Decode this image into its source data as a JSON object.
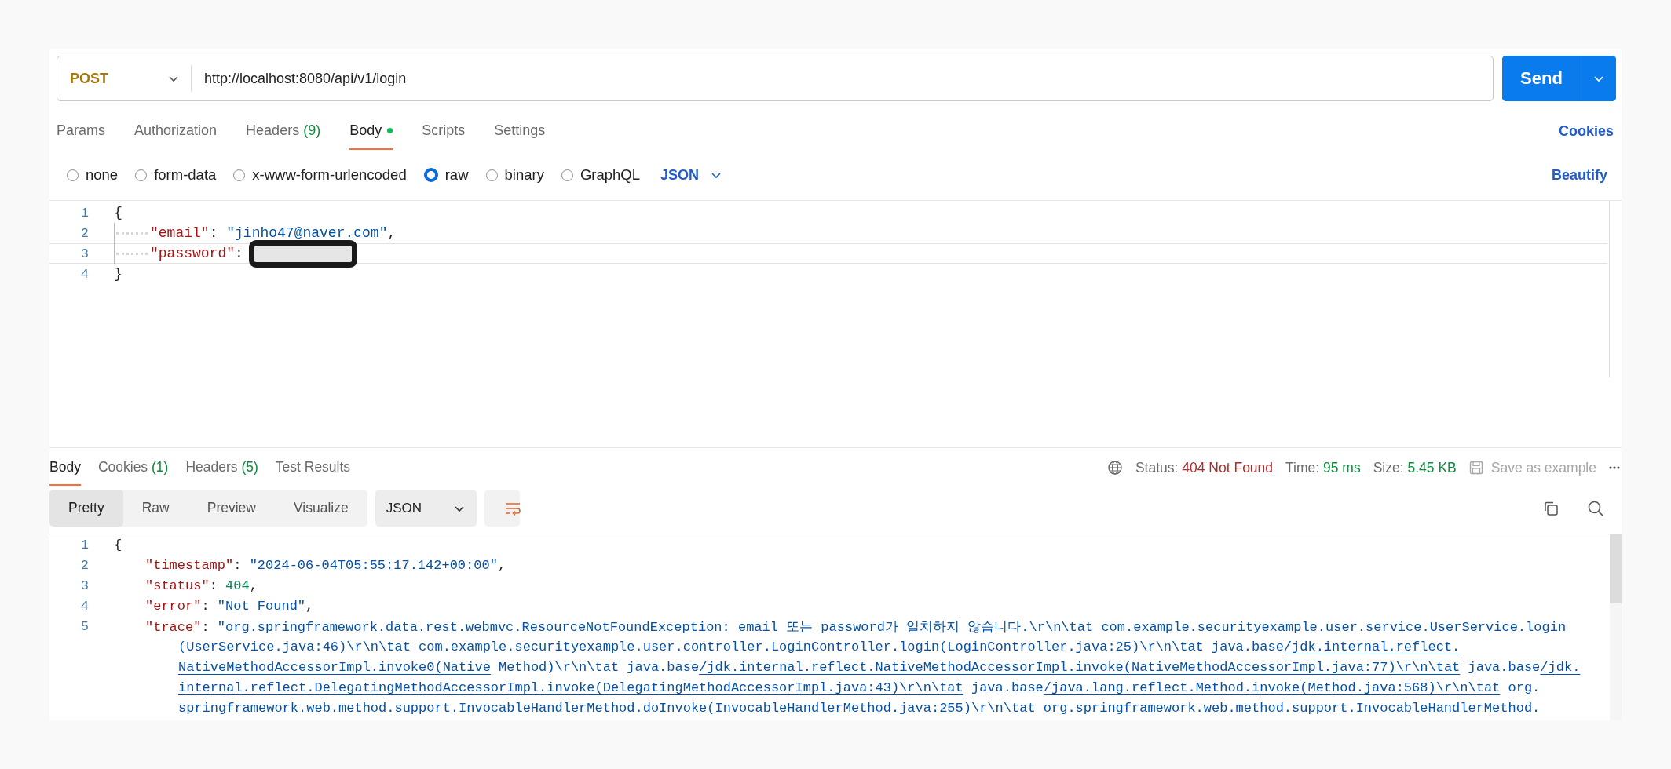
{
  "request": {
    "method": "POST",
    "url": "http://localhost:8080/api/v1/login",
    "send_label": "Send"
  },
  "request_tabs": [
    {
      "label": "Params",
      "selected": false,
      "has_content": false
    },
    {
      "label": "Authorization",
      "selected": false,
      "has_content": false
    },
    {
      "label": "Headers",
      "count": "(9)",
      "selected": false,
      "has_content": false
    },
    {
      "label": "Body",
      "selected": true,
      "has_content": true
    },
    {
      "label": "Scripts",
      "selected": false,
      "has_content": false
    },
    {
      "label": "Settings",
      "selected": false,
      "has_content": false
    }
  ],
  "cookies_link": "Cookies",
  "body_types": [
    {
      "label": "none",
      "selected": false
    },
    {
      "label": "form-data",
      "selected": false
    },
    {
      "label": "x-www-form-urlencoded",
      "selected": false
    },
    {
      "label": "raw",
      "selected": true
    },
    {
      "label": "binary",
      "selected": false
    },
    {
      "label": "GraphQL",
      "selected": false
    }
  ],
  "body_format": "JSON",
  "beautify_link": "Beautify",
  "request_body": {
    "lines": [
      {
        "number": "1",
        "indented": false,
        "current": false,
        "redacted": false,
        "tokens": [
          {
            "kind": "punct",
            "text": "{"
          }
        ]
      },
      {
        "number": "2",
        "indented": true,
        "current": false,
        "redacted": false,
        "tokens": [
          {
            "kind": "key",
            "text": "\"email\""
          },
          {
            "kind": "punct",
            "text": ": "
          },
          {
            "kind": "string",
            "text": "\"jinho47@naver.com\""
          },
          {
            "kind": "punct",
            "text": ","
          }
        ]
      },
      {
        "number": "3",
        "indented": true,
        "current": true,
        "redacted": true,
        "tokens": [
          {
            "kind": "key",
            "text": "\"password\""
          },
          {
            "kind": "punct",
            "text": ":"
          }
        ]
      },
      {
        "number": "4",
        "indented": false,
        "current": false,
        "redacted": false,
        "tokens": [
          {
            "kind": "punct",
            "text": "}"
          }
        ]
      }
    ]
  },
  "response_tabs": [
    {
      "label": "Body",
      "selected": true
    },
    {
      "label": "Cookies",
      "count": "(1)",
      "selected": false
    },
    {
      "label": "Headers",
      "count": "(5)",
      "selected": false
    },
    {
      "label": "Test Results",
      "selected": false
    }
  ],
  "response_status": {
    "status_label": "Status:",
    "status_value": "404 Not Found",
    "time_label": "Time:",
    "time_value": "95 ms",
    "size_label": "Size:",
    "size_value": "5.45 KB",
    "save_label": "Save as example",
    "save_disabled": true
  },
  "view_modes": [
    {
      "label": "Pretty",
      "selected": true
    },
    {
      "label": "Raw",
      "selected": false
    },
    {
      "label": "Preview",
      "selected": false
    },
    {
      "label": "Visualize",
      "selected": false
    }
  ],
  "response_format": "JSON",
  "response_body": {
    "lines": [
      {
        "number": "1",
        "indented": false,
        "tokens": [
          {
            "kind": "punct",
            "text": "{"
          }
        ]
      },
      {
        "number": "2",
        "indented": true,
        "tokens": [
          {
            "kind": "key",
            "text": "\"timestamp\""
          },
          {
            "kind": "punct",
            "text": ": "
          },
          {
            "kind": "string",
            "text": "\"2024-06-04T05:55:17.142+00:00\""
          },
          {
            "kind": "punct",
            "text": ","
          }
        ]
      },
      {
        "number": "3",
        "indented": true,
        "tokens": [
          {
            "kind": "key",
            "text": "\"status\""
          },
          {
            "kind": "punct",
            "text": ": "
          },
          {
            "kind": "number",
            "text": "404"
          },
          {
            "kind": "punct",
            "text": ","
          }
        ]
      },
      {
        "number": "4",
        "indented": true,
        "tokens": [
          {
            "kind": "key",
            "text": "\"error\""
          },
          {
            "kind": "punct",
            "text": ": "
          },
          {
            "kind": "string",
            "text": "\"Not Found\""
          },
          {
            "kind": "punct",
            "text": ","
          }
        ]
      },
      {
        "number": "5",
        "indented": true,
        "tokens": [
          {
            "kind": "key",
            "text": "\"trace\""
          },
          {
            "kind": "punct",
            "text": ": "
          },
          {
            "kind": "string",
            "text": "\"org.springframework.data.rest.webmvc.ResourceNotFoundException: email 또는 password가 일치하지 않습니다.\\r\\n\\tat com.example.securityexample.user.service.UserService.login"
          }
        ],
        "wraps": [
          {
            "tokens": [
              {
                "kind": "string",
                "text": "(UserService.java:46)\\r\\n\\tat com.example.securityexample.user.controller.LoginController.login(LoginController.java:25)\\r\\n\\tat java.base"
              },
              {
                "kind": "link",
                "text": "/jdk.internal.reflect."
              }
            ]
          },
          {
            "tokens": [
              {
                "kind": "link",
                "text": "NativeMethodAccessorImpl.invoke0(Native"
              },
              {
                "kind": "string",
                "text": " Method)\\r\\n\\tat java.base"
              },
              {
                "kind": "link",
                "text": "/jdk.internal.reflect.NativeMethodAccessorImpl.invoke(NativeMethodAccessorImpl.java:77)\\r\\n\\tat"
              },
              {
                "kind": "string",
                "text": " java.base"
              },
              {
                "kind": "link",
                "text": "/jdk."
              }
            ]
          },
          {
            "tokens": [
              {
                "kind": "link",
                "text": "internal.reflect.DelegatingMethodAccessorImpl.invoke(DelegatingMethodAccessorImpl.java:43)\\r\\n\\tat"
              },
              {
                "kind": "string",
                "text": " java.base"
              },
              {
                "kind": "link",
                "text": "/java.lang.reflect.Method.invoke(Method.java:568)\\r\\n\\tat"
              },
              {
                "kind": "string",
                "text": " org."
              }
            ]
          },
          {
            "tokens": [
              {
                "kind": "string",
                "text": "springframework.web.method.support.InvocableHandlerMethod.doInvoke(InvocableHandlerMethod.java:255)\\r\\n\\tat org.springframework.web.method.support.InvocableHandlerMethod."
              }
            ]
          }
        ]
      }
    ]
  }
}
